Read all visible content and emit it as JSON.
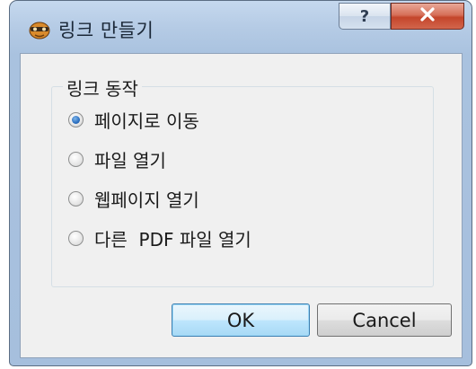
{
  "window": {
    "title": "링크 만들기",
    "help_label": "?",
    "close_icon": "close-x-icon",
    "app_icon": "pdf-app-icon"
  },
  "group": {
    "legend": "링크 동작",
    "options": [
      {
        "label": "페이지로 이동",
        "checked": true
      },
      {
        "label": "파일 열기",
        "checked": false
      },
      {
        "label": "웹페이지 열기",
        "checked": false
      },
      {
        "label": "다른  PDF 파일 열기",
        "checked": false
      }
    ]
  },
  "buttons": {
    "ok_label": "OK",
    "cancel_label": "Cancel"
  },
  "colors": {
    "frame": "#a9c2df",
    "close": "#c4452b",
    "radio_selected": "#2b6fc0",
    "ok_border": "#3c7fb1"
  }
}
